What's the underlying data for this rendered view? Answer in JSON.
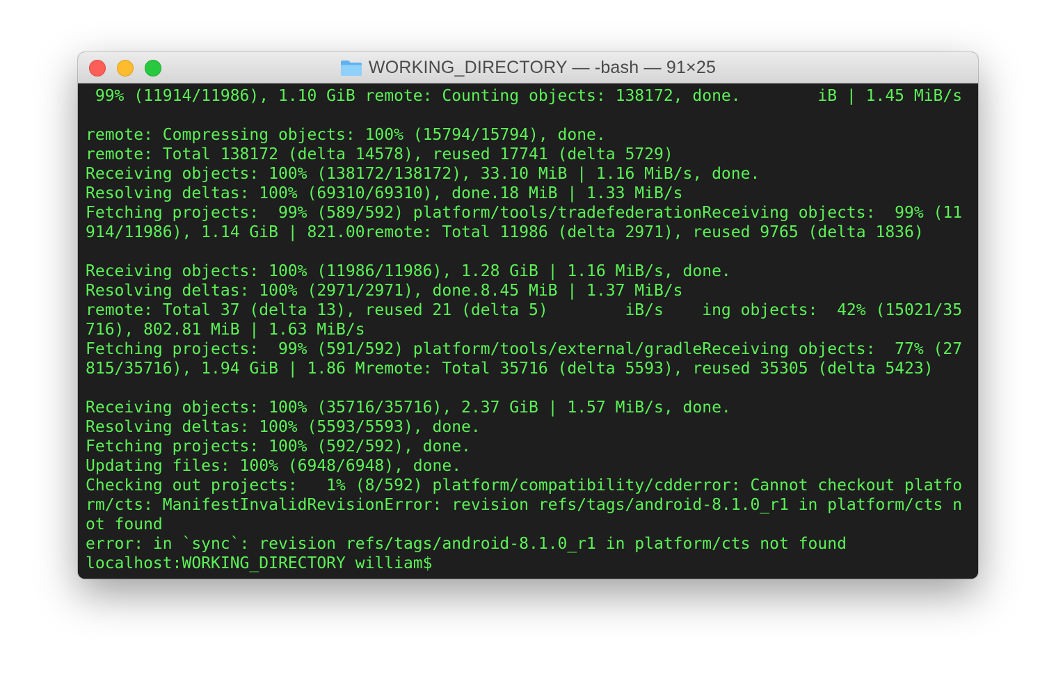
{
  "window": {
    "title": "WORKING_DIRECTORY — -bash — 91×25",
    "folder_icon": "folder-icon",
    "colors": {
      "terminal_background": "#1e1e1e",
      "terminal_text": "#5cf257",
      "close": "#fc5f57",
      "minimize": "#fdbc2e",
      "zoom": "#28c840"
    }
  },
  "terminal": {
    "lines": [
      " 99% (11914/11986), 1.10 GiB remote: Counting objects: 138172, done.        iB | 1.45 MiB/s",
      "",
      "remote: Compressing objects: 100% (15794/15794), done.",
      "remote: Total 138172 (delta 14578), reused 17741 (delta 5729)",
      "Receiving objects: 100% (138172/138172), 33.10 MiB | 1.16 MiB/s, done.",
      "Resolving deltas: 100% (69310/69310), done.18 MiB | 1.33 MiB/s",
      "Fetching projects:  99% (589/592) platform/tools/tradefederationReceiving objects:  99% (11",
      "914/11986), 1.14 GiB | 821.00remote: Total 11986 (delta 2971), reused 9765 (delta 1836)",
      "",
      "Receiving objects: 100% (11986/11986), 1.28 GiB | 1.16 MiB/s, done.",
      "Resolving deltas: 100% (2971/2971), done.8.45 MiB | 1.37 MiB/s",
      "remote: Total 37 (delta 13), reused 21 (delta 5)        iB/s    ing objects:  42% (15021/35",
      "716), 802.81 MiB | 1.63 MiB/s",
      "Fetching projects:  99% (591/592) platform/tools/external/gradleReceiving objects:  77% (27",
      "815/35716), 1.94 GiB | 1.86 Mremote: Total 35716 (delta 5593), reused 35305 (delta 5423)",
      "",
      "Receiving objects: 100% (35716/35716), 2.37 GiB | 1.57 MiB/s, done.",
      "Resolving deltas: 100% (5593/5593), done.",
      "Fetching projects: 100% (592/592), done.",
      "Updating files: 100% (6948/6948), done.",
      "Checking out projects:   1% (8/592) platform/compatibility/cdderror: Cannot checkout platfo",
      "rm/cts: ManifestInvalidRevisionError: revision refs/tags/android-8.1.0_r1 in platform/cts n",
      "ot found",
      "error: in `sync`: revision refs/tags/android-8.1.0_r1 in platform/cts not found",
      "localhost:WORKING_DIRECTORY william$"
    ]
  }
}
